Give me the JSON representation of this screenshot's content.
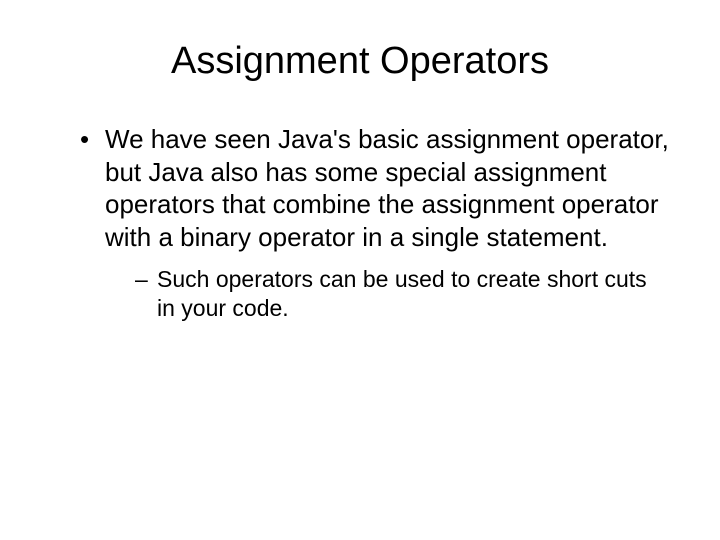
{
  "title": "Assignment Operators",
  "bullets": [
    {
      "text": "We have seen Java's basic assignment operator, but Java also has some special assignment operators that combine the assignment operator with a binary operator in a single statement.",
      "sub": [
        "Such operators can be used to create short cuts in your code."
      ]
    }
  ]
}
